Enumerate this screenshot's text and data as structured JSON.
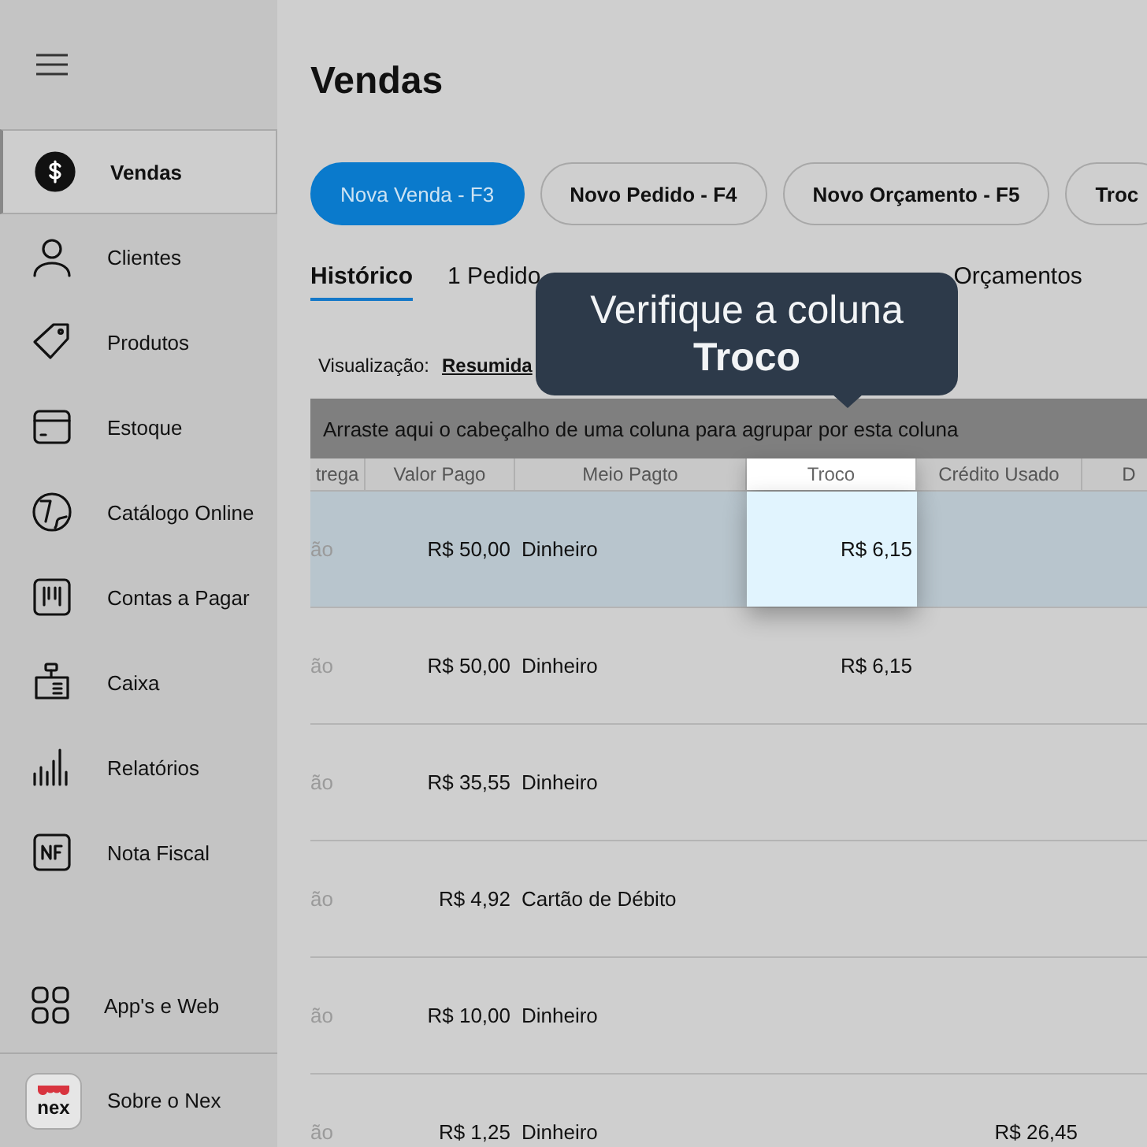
{
  "sidebar": {
    "items": [
      {
        "label": "Vendas",
        "selected": true
      },
      {
        "label": "Clientes",
        "selected": false
      },
      {
        "label": "Produtos",
        "selected": false
      },
      {
        "label": "Estoque",
        "selected": false
      },
      {
        "label": "Catálogo Online",
        "selected": false
      },
      {
        "label": "Contas a Pagar",
        "selected": false
      },
      {
        "label": "Caixa",
        "selected": false
      },
      {
        "label": "Relatórios",
        "selected": false
      },
      {
        "label": "Nota Fiscal",
        "selected": false
      }
    ],
    "bottom_items": [
      {
        "label": "App's e Web"
      },
      {
        "label": "Sobre o Nex",
        "logo_text": "nex"
      }
    ]
  },
  "page_title": "Vendas",
  "actions": [
    {
      "label": "Nova Venda - F3",
      "kind": "primary"
    },
    {
      "label": "Novo Pedido - F4",
      "kind": "outline"
    },
    {
      "label": "Novo Orçamento - F5",
      "kind": "outline"
    },
    {
      "label": "Troc",
      "kind": "outline"
    }
  ],
  "tabs": [
    {
      "label": "Histórico",
      "selected": true
    },
    {
      "label": "1 Pedido",
      "selected": false
    },
    {
      "label": "Orçamentos",
      "selected": false
    }
  ],
  "view": {
    "label": "Visualização:",
    "value": "Resumida"
  },
  "group_panel": "Arraste aqui o cabeçalho de uma coluna para agrupar por esta coluna",
  "table": {
    "columns": [
      {
        "label": "trega",
        "highlighted": false
      },
      {
        "label": "Valor Pago",
        "highlighted": false
      },
      {
        "label": "Meio Pagto",
        "highlighted": false
      },
      {
        "label": "Troco",
        "highlighted": true
      },
      {
        "label": "Crédito Usado",
        "highlighted": false
      },
      {
        "label": "D",
        "highlighted": false
      }
    ],
    "rows": [
      {
        "selected": true,
        "cells": [
          "ão",
          "R$ 50,00",
          "Dinheiro",
          "R$ 6,15",
          "",
          ""
        ]
      },
      {
        "selected": false,
        "cells": [
          "ão",
          "R$ 50,00",
          "Dinheiro",
          "R$ 6,15",
          "",
          ""
        ]
      },
      {
        "selected": false,
        "cells": [
          "ão",
          "R$ 35,55",
          "Dinheiro",
          "",
          "",
          ""
        ]
      },
      {
        "selected": false,
        "cells": [
          "ão",
          "R$ 4,92",
          "Cartão de Débito",
          "",
          "",
          ""
        ]
      },
      {
        "selected": false,
        "cells": [
          "ão",
          "R$ 10,00",
          "Dinheiro",
          "",
          "",
          ""
        ]
      },
      {
        "selected": false,
        "cells": [
          "ão",
          "R$ 1,25",
          "Dinheiro",
          "",
          "R$ 26,45",
          ""
        ]
      }
    ]
  },
  "tooltip": "Verifique a coluna **Troco**"
}
